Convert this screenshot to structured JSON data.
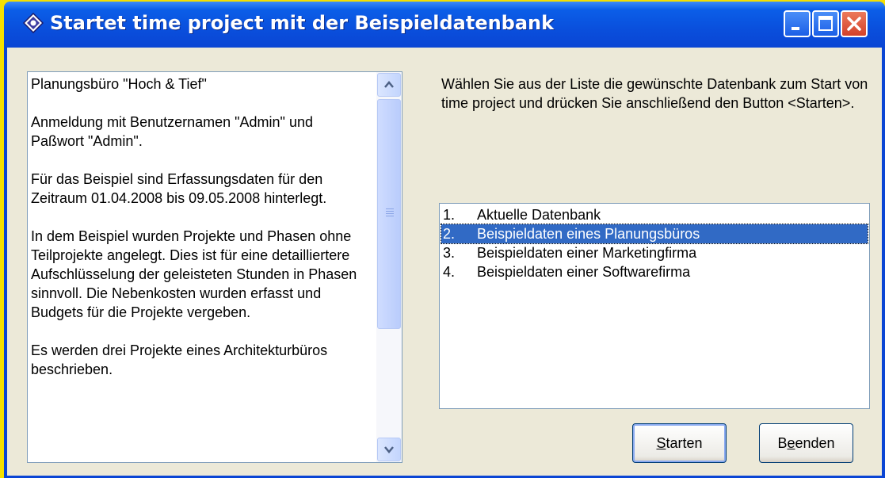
{
  "window": {
    "title": "Startet time project mit der Beispieldatenbank"
  },
  "description": {
    "paragraphs": [
      "Planungsbüro \"Hoch & Tief\"",
      "Anmeldung mit Benutzernamen \"Admin\" und Paßwort \"Admin\".",
      "Für das Beispiel sind Erfassungsdaten für den Zeitraum 01.04.2008 bis 09.05.2008 hinterlegt.",
      "In dem Beispiel wurden Projekte und Phasen ohne Teilprojekte angelegt. Dies ist für eine detailliertere Aufschlüsselung der geleisteten Stunden in Phasen sinnvoll. Die Nebenkosten wurden erfasst und Budgets für die Projekte vergeben.",
      "Es werden drei Projekte eines Architekturbüros beschrieben."
    ]
  },
  "instruction": "Wählen Sie aus der Liste die gewünschte Datenbank zum Start von time project und drücken Sie anschließend den Button <Starten>.",
  "database_list": {
    "items": [
      {
        "number": "1.",
        "label": "Aktuelle Datenbank"
      },
      {
        "number": "2.",
        "label": "Beispieldaten eines Planungsbüros"
      },
      {
        "number": "3.",
        "label": "Beispieldaten einer Marketingfirma"
      },
      {
        "number": "4.",
        "label": "Beispieldaten einer Softwarefirma"
      }
    ],
    "selected_index": 1
  },
  "buttons": {
    "start_label": "Starten",
    "exit_label": "Beenden"
  },
  "icons": {
    "app": "app-diamond-icon",
    "minimize": "minimize-icon",
    "maximize": "maximize-icon",
    "close": "close-icon",
    "scroll_up": "chevron-up-icon",
    "scroll_down": "chevron-down-icon"
  },
  "colors": {
    "title_bar": "#0a45d4",
    "selection": "#316ac5",
    "desktop": "#f5e000"
  }
}
